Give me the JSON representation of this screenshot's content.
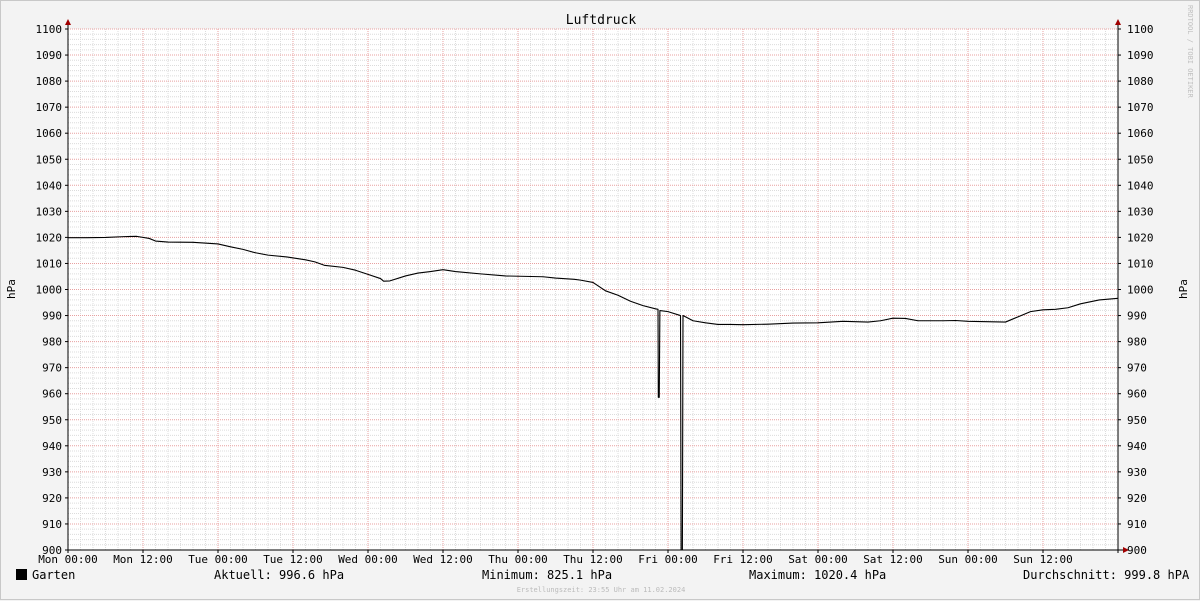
{
  "chart_data": {
    "type": "line",
    "title": "Luftdruck",
    "ylabel": "hPa",
    "ylim": [
      900,
      1100
    ],
    "yticks": [
      900,
      910,
      920,
      930,
      940,
      950,
      960,
      970,
      980,
      990,
      1000,
      1010,
      1020,
      1030,
      1040,
      1050,
      1060,
      1070,
      1080,
      1090,
      1100
    ],
    "xlim_hours": [
      0,
      168
    ],
    "xticks": [
      {
        "label": "Mon 00:00",
        "hour": 0
      },
      {
        "label": "Mon 12:00",
        "hour": 12
      },
      {
        "label": "Tue 00:00",
        "hour": 24
      },
      {
        "label": "Tue 12:00",
        "hour": 36
      },
      {
        "label": "Wed 00:00",
        "hour": 48
      },
      {
        "label": "Wed 12:00",
        "hour": 60
      },
      {
        "label": "Thu 00:00",
        "hour": 72
      },
      {
        "label": "Thu 12:00",
        "hour": 84
      },
      {
        "label": "Fri 00:00",
        "hour": 96
      },
      {
        "label": "Fri 12:00",
        "hour": 108
      },
      {
        "label": "Sat 00:00",
        "hour": 120
      },
      {
        "label": "Sat 12:00",
        "hour": 132
      },
      {
        "label": "Sun 00:00",
        "hour": 144
      },
      {
        "label": "Sun 12:00",
        "hour": 156
      }
    ],
    "grid": true,
    "series": [
      {
        "name": "Garten",
        "color": "#000000",
        "points": [
          [
            0,
            1019.9
          ],
          [
            3,
            1019.9
          ],
          [
            6,
            1020.0
          ],
          [
            9,
            1020.3
          ],
          [
            11,
            1020.4
          ],
          [
            13,
            1019.6
          ],
          [
            14,
            1018.6
          ],
          [
            16,
            1018.2
          ],
          [
            20,
            1018.1
          ],
          [
            24,
            1017.5
          ],
          [
            26,
            1016.4
          ],
          [
            28,
            1015.4
          ],
          [
            30,
            1014.1
          ],
          [
            32,
            1013.2
          ],
          [
            35,
            1012.5
          ],
          [
            38,
            1011.4
          ],
          [
            39.5,
            1010.6
          ],
          [
            41,
            1009.3
          ],
          [
            44,
            1008.5
          ],
          [
            46,
            1007.4
          ],
          [
            48,
            1005.8
          ],
          [
            50,
            1004.2
          ],
          [
            50.5,
            1003.2
          ],
          [
            51.5,
            1003.3
          ],
          [
            54,
            1005.2
          ],
          [
            56,
            1006.3
          ],
          [
            58,
            1006.9
          ],
          [
            60,
            1007.6
          ],
          [
            62,
            1006.9
          ],
          [
            66,
            1006.0
          ],
          [
            70,
            1005.2
          ],
          [
            76,
            1004.9
          ],
          [
            78,
            1004.4
          ],
          [
            81,
            1003.9
          ],
          [
            82,
            1003.6
          ],
          [
            84,
            1002.7
          ],
          [
            86,
            999.5
          ],
          [
            88,
            997.8
          ],
          [
            90,
            995.5
          ],
          [
            92,
            993.8
          ],
          [
            94,
            992.6
          ],
          [
            94.4,
            992.4
          ],
          [
            94.45,
            958.6
          ],
          [
            94.6,
            958.6
          ],
          [
            94.7,
            991.9
          ],
          [
            96,
            991.5
          ],
          [
            98,
            990.0
          ],
          [
            98.1,
            899.5
          ],
          [
            98.3,
            899.5
          ],
          [
            98.4,
            990.0
          ],
          [
            100,
            988.0
          ],
          [
            102,
            987.2
          ],
          [
            104,
            986.6
          ],
          [
            106,
            986.6
          ],
          [
            108,
            986.5
          ],
          [
            112,
            986.7
          ],
          [
            116,
            987.1
          ],
          [
            120,
            987.2
          ],
          [
            124,
            987.8
          ],
          [
            128,
            987.5
          ],
          [
            130,
            988.0
          ],
          [
            132,
            989.0
          ],
          [
            134,
            988.9
          ],
          [
            136,
            988.0
          ],
          [
            140,
            988.0
          ],
          [
            142,
            988.1
          ],
          [
            144,
            987.8
          ],
          [
            148,
            987.6
          ],
          [
            150,
            987.5
          ],
          [
            152,
            989.5
          ],
          [
            154,
            991.5
          ],
          [
            156,
            992.2
          ],
          [
            158,
            992.4
          ],
          [
            160,
            993.0
          ],
          [
            162,
            994.5
          ],
          [
            165,
            996.0
          ],
          [
            168,
            996.6
          ]
        ]
      }
    ]
  },
  "legend": {
    "series_name": "Garten",
    "aktuell": "Aktuell: 996.6 hPa",
    "minimum": "Minimum: 825.1 hPa",
    "maximum": "Maximum: 1020.4 hPa",
    "durchschnitt": "Durchschnitt: 999.8 hPA"
  },
  "footer": {
    "timestamp": "Erstellungszeit: 23:55 Uhr am 11.02.2024",
    "watermark": "RRDTOOL / TOBI OETIKER"
  },
  "colors": {
    "minor_grid": "#dcdcdc",
    "major_grid": "#e8a0a0",
    "axis": "#000000",
    "arrow": "#a00000",
    "canvas": "#ffffff",
    "background": "#f3f3f3"
  }
}
